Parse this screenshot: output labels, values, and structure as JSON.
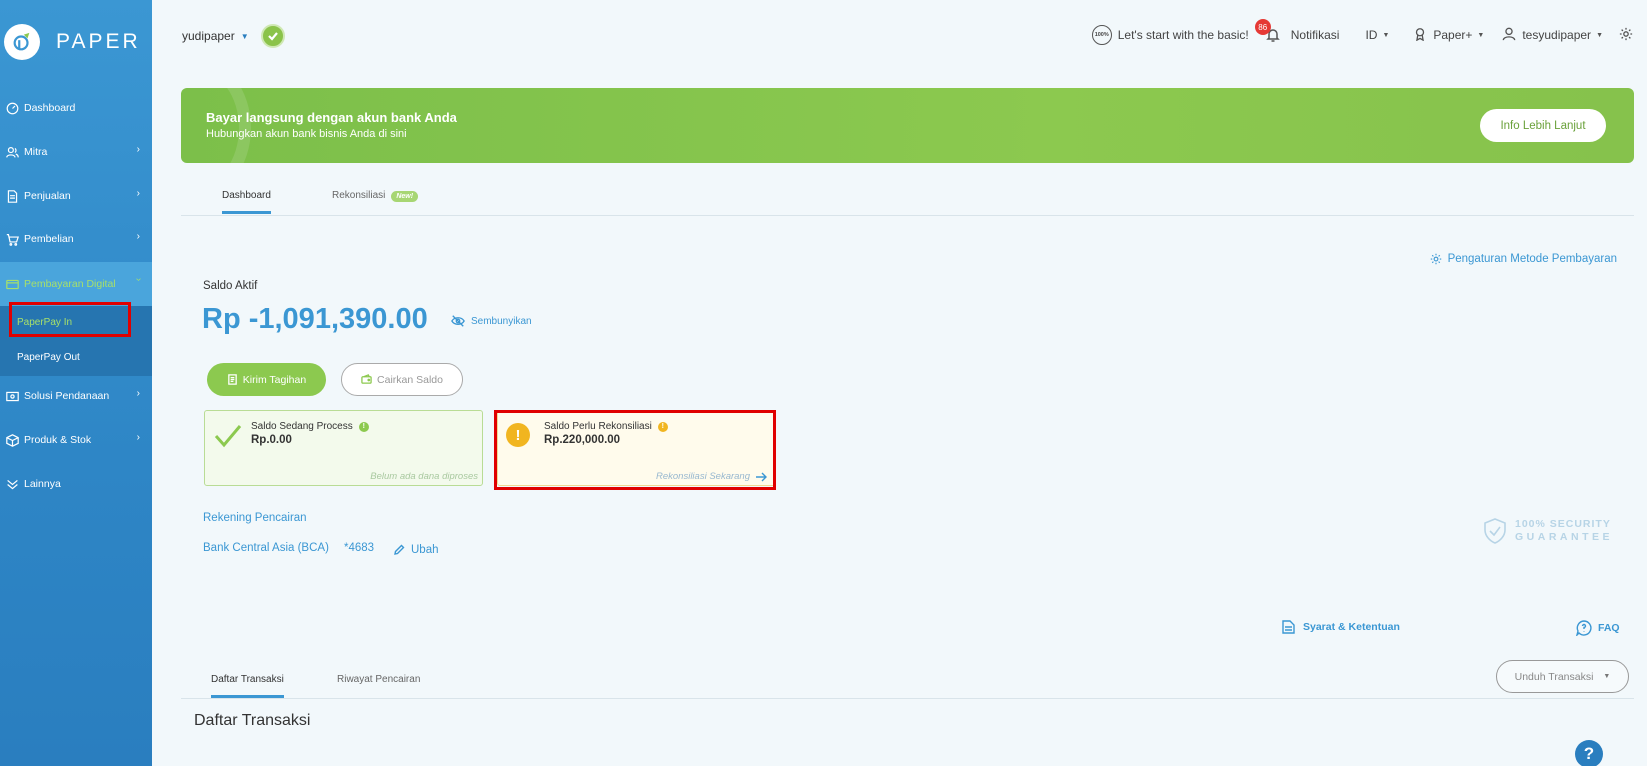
{
  "brand": {
    "name": "PAPER"
  },
  "sidebar": {
    "items": [
      {
        "label": "Dashboard",
        "icon": "dashboard-icon"
      },
      {
        "label": "Mitra",
        "icon": "users-icon"
      },
      {
        "label": "Penjualan",
        "icon": "document-icon"
      },
      {
        "label": "Pembelian",
        "icon": "cart-icon"
      },
      {
        "label": "Pembayaran Digital",
        "icon": "card-icon"
      },
      {
        "label": "Solusi Pendanaan",
        "icon": "money-icon"
      },
      {
        "label": "Produk & Stok",
        "icon": "box-icon"
      },
      {
        "label": "Lainnya",
        "icon": "more-icon"
      }
    ],
    "submenu": [
      {
        "label": "PaperPay In"
      },
      {
        "label": "PaperPay Out"
      }
    ],
    "chevron": "›"
  },
  "topbar": {
    "company": "yudipaper",
    "basic_label": "Let's start with the basic!",
    "hundred_label": "100%",
    "notif_count": "86",
    "notif_label": "Notifikasi",
    "language": "ID",
    "plan": "Paper+",
    "user": "tesyudipaper"
  },
  "banner": {
    "title": "Bayar langsung dengan akun bank Anda",
    "subtitle": "Hubungkan akun bank bisnis Anda di sini",
    "button": "Info Lebih Lanjut"
  },
  "tabs": [
    {
      "label": "Dashboard"
    },
    {
      "label": "Rekonsiliasi",
      "badge": "New!"
    }
  ],
  "payment_settings": "Pengaturan Metode Pembayaran",
  "saldo": {
    "label": "Saldo Aktif",
    "amount": "Rp -1,091,390.00",
    "hide_label": "Sembunyikan"
  },
  "actions": {
    "send_invoice": "Kirim Tagihan",
    "withdraw": "Cairkan Saldo"
  },
  "cards": {
    "processing": {
      "title": "Saldo Sedang Process",
      "amount": "Rp.0.00",
      "footer": "Belum ada dana diproses"
    },
    "reconcile": {
      "title": "Saldo Perlu Rekonsiliasi",
      "amount": "Rp.220,000.00",
      "footer": "Rekonsiliasi Sekarang",
      "warn_symbol": "!"
    }
  },
  "bank": {
    "title": "Rekening Pencairan",
    "name": "Bank Central Asia (BCA)",
    "account": "*4683",
    "edit": "Ubah"
  },
  "security": {
    "line1": "100% SECURITY",
    "line2": "GUARANTEE"
  },
  "links": {
    "terms": "Syarat & Ketentuan",
    "faq": "FAQ"
  },
  "transaction_tabs": [
    {
      "label": "Daftar Transaksi"
    },
    {
      "label": "Riwayat Pencairan"
    }
  ],
  "download": "Unduh Transaksi",
  "transactions_heading": "Daftar Transaksi",
  "help_symbol": "?",
  "colors": {
    "primary": "#3b97d3",
    "green": "#8cc94f",
    "highlight_red": "#e00000",
    "warning": "#f1b520"
  }
}
